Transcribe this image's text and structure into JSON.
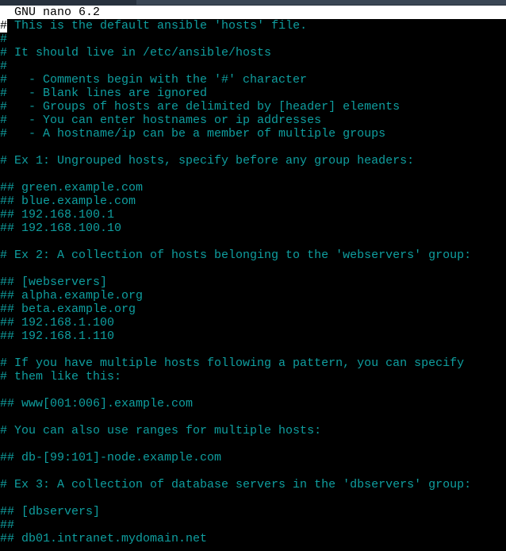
{
  "app": {
    "name": "GNU nano",
    "title": "GNU nano 6.2"
  },
  "colors": {
    "background": "#000000",
    "text": "#0f9fa0",
    "titlebar_bg": "#ffffff",
    "titlebar_fg": "#000000",
    "cursor_bg": "#ffffff"
  },
  "editor": {
    "cursor": {
      "line": 1,
      "column": 1,
      "char": "#"
    },
    "first_line_rest": " This is the default ansible 'hosts' file.",
    "lines": [
      "# This is the default ansible 'hosts' file.",
      "#",
      "# It should live in /etc/ansible/hosts",
      "#",
      "#   - Comments begin with the '#' character",
      "#   - Blank lines are ignored",
      "#   - Groups of hosts are delimited by [header] elements",
      "#   - You can enter hostnames or ip addresses",
      "#   - A hostname/ip can be a member of multiple groups",
      "",
      "# Ex 1: Ungrouped hosts, specify before any group headers:",
      "",
      "## green.example.com",
      "## blue.example.com",
      "## 192.168.100.1",
      "## 192.168.100.10",
      "",
      "# Ex 2: A collection of hosts belonging to the 'webservers' group:",
      "",
      "## [webservers]",
      "## alpha.example.org",
      "## beta.example.org",
      "## 192.168.1.100",
      "## 192.168.1.110",
      "",
      "# If you have multiple hosts following a pattern, you can specify",
      "# them like this:",
      "",
      "## www[001:006].example.com",
      "",
      "# You can also use ranges for multiple hosts:",
      "",
      "## db-[99:101]-node.example.com",
      "",
      "# Ex 3: A collection of database servers in the 'dbservers' group:",
      "",
      "## [dbservers]",
      "##",
      "## db01.intranet.mydomain.net"
    ]
  }
}
